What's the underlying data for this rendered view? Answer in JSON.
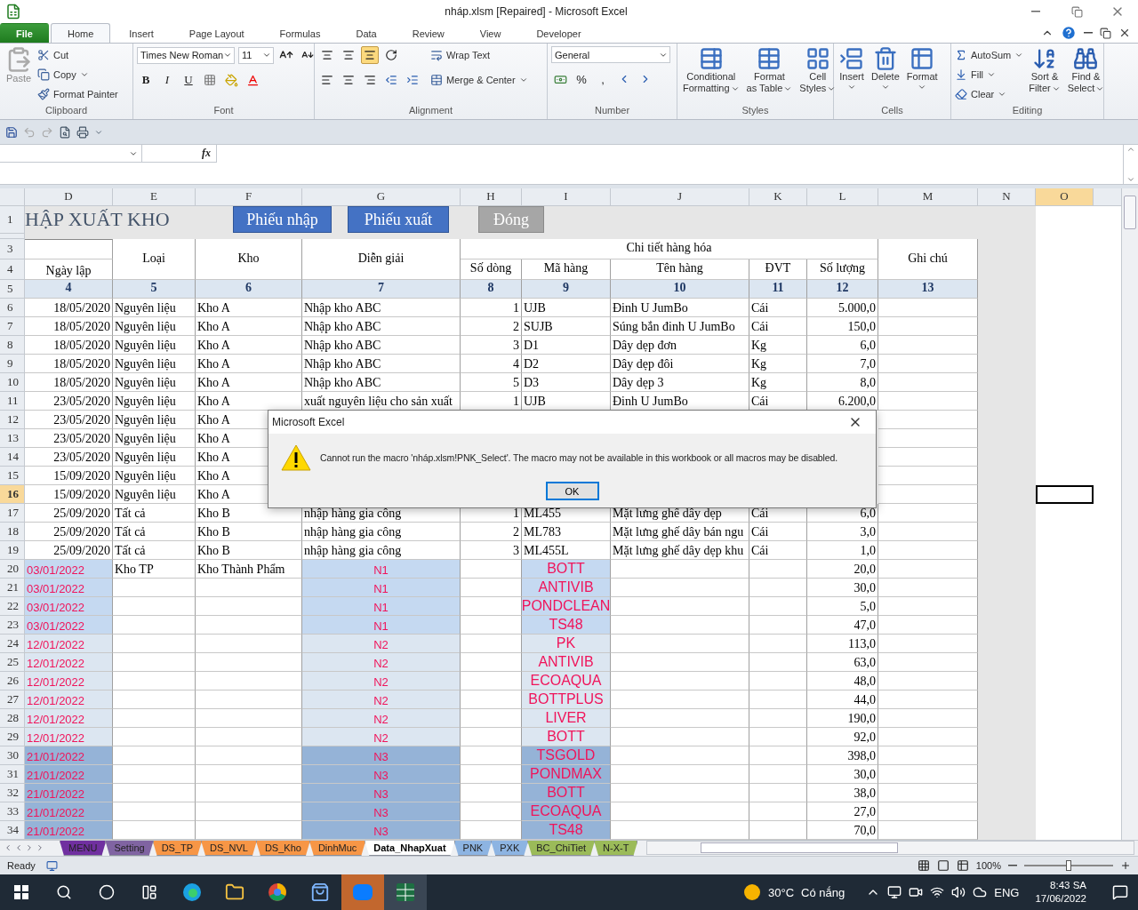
{
  "window": {
    "title": "nháp.xlsm [Repaired]  -  Microsoft Excel"
  },
  "ribbon_tabs": [
    {
      "label": "File",
      "kind": "file",
      "selected": false
    },
    {
      "label": "Home",
      "kind": "tab",
      "selected": true
    },
    {
      "label": "Insert",
      "kind": "tab",
      "selected": false
    },
    {
      "label": "Page Layout",
      "kind": "tab",
      "selected": false
    },
    {
      "label": "Formulas",
      "kind": "tab",
      "selected": false
    },
    {
      "label": "Data",
      "kind": "tab",
      "selected": false
    },
    {
      "label": "Review",
      "kind": "tab",
      "selected": false
    },
    {
      "label": "View",
      "kind": "tab",
      "selected": false
    },
    {
      "label": "Developer",
      "kind": "tab",
      "selected": false
    }
  ],
  "clipboard": {
    "label": "Clipboard",
    "paste": {
      "label": "Paste",
      "disabled": true
    },
    "items": [
      {
        "label": "Cut",
        "dropdown": false
      },
      {
        "label": "Copy",
        "dropdown": true
      },
      {
        "label": "Format Painter",
        "dropdown": false
      }
    ]
  },
  "font": {
    "label": "Font",
    "name": "Times New Roman",
    "size": "11",
    "styles": [
      "B",
      "I",
      "U"
    ]
  },
  "alignment": {
    "label": "Alignment",
    "vertical": [
      {
        "selected": false
      },
      {
        "selected": false
      },
      {
        "selected": true
      }
    ],
    "wrap": "Wrap Text",
    "merge": "Merge & Center"
  },
  "number": {
    "label": "Number",
    "format": "General",
    "symbols": [
      "%",
      ","
    ]
  },
  "styles": {
    "label": "Styles",
    "items": [
      {
        "lines": [
          "Conditional",
          "Formatting"
        ]
      },
      {
        "lines": [
          "Format",
          "as Table"
        ]
      },
      {
        "lines": [
          "Cell",
          "Styles"
        ]
      }
    ]
  },
  "cells": {
    "label": "Cells",
    "items": [
      "Insert",
      "Delete",
      "Format"
    ]
  },
  "editing": {
    "label": "Editing",
    "small": [
      "AutoSum",
      "Fill",
      "Clear"
    ],
    "large": [
      {
        "lines": [
          "Sort &",
          "Filter"
        ]
      },
      {
        "lines": [
          "Find &",
          "Select"
        ]
      }
    ]
  },
  "formula_bar": {
    "fx": "fx"
  },
  "columns": [
    {
      "label": "D",
      "selected": false
    },
    {
      "label": "E",
      "selected": false
    },
    {
      "label": "F",
      "selected": false
    },
    {
      "label": "G",
      "selected": false
    },
    {
      "label": "H",
      "selected": false
    },
    {
      "label": "I",
      "selected": false
    },
    {
      "label": "J",
      "selected": false
    },
    {
      "label": "K",
      "selected": false
    },
    {
      "label": "L",
      "selected": false
    },
    {
      "label": "M",
      "selected": false
    },
    {
      "label": "N",
      "selected": false
    },
    {
      "label": "O",
      "selected": true
    }
  ],
  "title_row": {
    "number": "1",
    "title": "HẬP XUẤT KHO",
    "buttons": [
      {
        "label": "Phiếu nhập",
        "kind": "primary"
      },
      {
        "label": "Phiếu xuất",
        "kind": "primary"
      },
      {
        "label": "Đóng",
        "kind": "secondary"
      }
    ]
  },
  "header": {
    "row_numbers": [
      "3",
      "4",
      "5"
    ],
    "date": "Ngày lập",
    "type": "Loại",
    "warehouse": "Kho",
    "description": "Diễn giải",
    "detail": "Chi tiết hàng hóa",
    "sub": [
      "Số dòng",
      "Mã hàng",
      "Tên hàng",
      "ĐVT",
      "Số lượng"
    ],
    "note": "Ghi chú",
    "numbers": [
      "4",
      "5",
      "6",
      "7",
      "8",
      "9",
      "10",
      "11",
      "12",
      "13"
    ]
  },
  "rows": [
    {
      "n": "6",
      "kind": "text",
      "selected": false,
      "cells": {
        "D": "18/05/2020",
        "E": "Nguyên liệu",
        "F": "Kho A",
        "G": "Nhập kho ABC",
        "H": "1",
        "I": "UJB",
        "J": "Đinh U JumBo",
        "K": "Cái",
        "L": "5.000,0"
      }
    },
    {
      "n": "7",
      "kind": "text",
      "selected": false,
      "cells": {
        "D": "18/05/2020",
        "E": "Nguyên liệu",
        "F": "Kho A",
        "G": "Nhập kho ABC",
        "H": "2",
        "I": "SUJB",
        "J": "Súng bắn đinh U JumBo",
        "K": "Cái",
        "L": "150,0"
      }
    },
    {
      "n": "8",
      "kind": "text",
      "selected": false,
      "cells": {
        "D": "18/05/2020",
        "E": "Nguyên liệu",
        "F": "Kho A",
        "G": "Nhập kho ABC",
        "H": "3",
        "I": "D1",
        "J": "Dây dẹp đơn",
        "K": "Kg",
        "L": "6,0"
      }
    },
    {
      "n": "9",
      "kind": "text",
      "selected": false,
      "cells": {
        "D": "18/05/2020",
        "E": "Nguyên liệu",
        "F": "Kho A",
        "G": "Nhập kho ABC",
        "H": "4",
        "I": "D2",
        "J": "Dây dẹp đôi",
        "K": "Kg",
        "L": "7,0"
      }
    },
    {
      "n": "10",
      "kind": "text",
      "selected": false,
      "cells": {
        "D": "18/05/2020",
        "E": "Nguyên liệu",
        "F": "Kho A",
        "G": "Nhập kho ABC",
        "H": "5",
        "I": "D3",
        "J": "Dây dẹp 3",
        "K": "Kg",
        "L": "8,0"
      }
    },
    {
      "n": "11",
      "kind": "text",
      "selected": false,
      "cells": {
        "D": "23/05/2020",
        "E": "Nguyên liệu",
        "F": "Kho A",
        "G": "xuất nguyên liệu cho sản xuất",
        "H": "1",
        "I": "UJB",
        "J": "Đinh U JumBo",
        "K": "Cái",
        "L": "6.200,0"
      }
    },
    {
      "n": "12",
      "kind": "text",
      "selected": false,
      "cells": {
        "D": "23/05/2020",
        "E": "Nguyên liệu",
        "F": "Kho A"
      }
    },
    {
      "n": "13",
      "kind": "text",
      "selected": false,
      "cells": {
        "D": "23/05/2020",
        "E": "Nguyên liệu",
        "F": "Kho A"
      }
    },
    {
      "n": "14",
      "kind": "text",
      "selected": false,
      "cells": {
        "D": "23/05/2020",
        "E": "Nguyên liệu",
        "F": "Kho A"
      }
    },
    {
      "n": "15",
      "kind": "text",
      "selected": false,
      "cells": {
        "D": "15/09/2020",
        "E": "Nguyên liệu",
        "F": "Kho A"
      }
    },
    {
      "n": "16",
      "kind": "text",
      "selected": true,
      "cells": {
        "D": "15/09/2020",
        "E": "Nguyên liệu",
        "F": "Kho A"
      }
    },
    {
      "n": "17",
      "kind": "text",
      "selected": false,
      "cells": {
        "D": "25/09/2020",
        "E": "Tất cả",
        "F": "Kho B",
        "G": "nhập hàng gia công",
        "H": "1",
        "I": "ML455",
        "J": "Mặt lưng ghế dây dẹp",
        "K": "Cái",
        "L": "6,0"
      }
    },
    {
      "n": "18",
      "kind": "text",
      "selected": false,
      "cells": {
        "D": "25/09/2020",
        "E": "Tất cả",
        "F": "Kho B",
        "G": "nhập hàng gia công",
        "H": "2",
        "I": "ML783",
        "J": "Mặt lưng ghế dây bán ngu",
        "K": "Cái",
        "L": "3,0"
      }
    },
    {
      "n": "19",
      "kind": "text",
      "selected": false,
      "cells": {
        "D": "25/09/2020",
        "E": "Tất cả",
        "F": "Kho B",
        "G": "nhập hàng gia công",
        "H": "3",
        "I": "ML455L",
        "J": "Mặt lưng ghế dây dẹp khu",
        "K": "Cái",
        "L": "1,0"
      }
    },
    {
      "n": "20",
      "kind": "import",
      "selected": false,
      "color": "#c5d9f1",
      "cells": {
        "D": "03/01/2022",
        "E": "Kho TP",
        "F": "Kho Thành Phẩm",
        "G": "N1",
        "I": "BOTT",
        "L": "20,0"
      }
    },
    {
      "n": "21",
      "kind": "import",
      "selected": false,
      "color": "#c5d9f1",
      "cells": {
        "D": "03/01/2022",
        "G": "N1",
        "I": "ANTIVIB",
        "L": "30,0"
      }
    },
    {
      "n": "22",
      "kind": "import",
      "selected": false,
      "color": "#c5d9f1",
      "cells": {
        "D": "03/01/2022",
        "G": "N1",
        "I": "PONDCLEAN",
        "L": "5,0"
      }
    },
    {
      "n": "23",
      "kind": "import",
      "selected": false,
      "color": "#c5d9f1",
      "cells": {
        "D": "03/01/2022",
        "G": "N1",
        "I": "TS48",
        "L": "47,0"
      }
    },
    {
      "n": "24",
      "kind": "import",
      "selected": false,
      "color": "#dce6f1",
      "cells": {
        "D": "12/01/2022",
        "G": "N2",
        "I": "PK",
        "L": "113,0"
      }
    },
    {
      "n": "25",
      "kind": "import",
      "selected": false,
      "color": "#dce6f1",
      "cells": {
        "D": "12/01/2022",
        "G": "N2",
        "I": "ANTIVIB",
        "L": "63,0"
      }
    },
    {
      "n": "26",
      "kind": "import",
      "selected": false,
      "color": "#dce6f1",
      "cells": {
        "D": "12/01/2022",
        "G": "N2",
        "I": "ECOAQUA",
        "L": "48,0"
      }
    },
    {
      "n": "27",
      "kind": "import",
      "selected": false,
      "color": "#dce6f1",
      "cells": {
        "D": "12/01/2022",
        "G": "N2",
        "I": "BOTTPLUS",
        "L": "44,0"
      }
    },
    {
      "n": "28",
      "kind": "import",
      "selected": false,
      "color": "#dce6f1",
      "cells": {
        "D": "12/01/2022",
        "G": "N2",
        "I": "LIVER",
        "L": "190,0"
      }
    },
    {
      "n": "29",
      "kind": "import",
      "selected": false,
      "color": "#dce6f1",
      "cells": {
        "D": "12/01/2022",
        "G": "N2",
        "I": "BOTT",
        "L": "92,0"
      }
    },
    {
      "n": "30",
      "kind": "import",
      "selected": false,
      "color": "#95b3d7",
      "cells": {
        "D": "21/01/2022",
        "G": "N3",
        "I": "TSGOLD",
        "L": "398,0"
      }
    },
    {
      "n": "31",
      "kind": "import",
      "selected": false,
      "color": "#95b3d7",
      "cells": {
        "D": "21/01/2022",
        "G": "N3",
        "I": "PONDMAX",
        "L": "30,0"
      }
    },
    {
      "n": "32",
      "kind": "import",
      "selected": false,
      "color": "#95b3d7",
      "cells": {
        "D": "21/01/2022",
        "G": "N3",
        "I": "BOTT",
        "L": "38,0"
      }
    },
    {
      "n": "33",
      "kind": "import",
      "selected": false,
      "color": "#95b3d7",
      "cells": {
        "D": "21/01/2022",
        "G": "N3",
        "I": "ECOAQUA",
        "L": "27,0"
      }
    },
    {
      "n": "34",
      "kind": "import",
      "selected": false,
      "color": "#95b3d7",
      "cells": {
        "D": "21/01/2022",
        "G": "N3",
        "I": "TS48",
        "L": "70,0"
      }
    }
  ],
  "sheet_tabs": [
    {
      "label": "MENU",
      "color": "#7030a0",
      "selected": false
    },
    {
      "label": "Setting",
      "color": "#8064a2",
      "selected": false
    },
    {
      "label": "DS_TP",
      "color": "#f79646",
      "selected": false
    },
    {
      "label": "DS_NVL",
      "color": "#f79646",
      "selected": false
    },
    {
      "label": "DS_Kho",
      "color": "#f79646",
      "selected": false
    },
    {
      "label": "DinhMuc",
      "color": "#f79646",
      "selected": false
    },
    {
      "label": "Data_NhapXuat",
      "color": "#ffffff",
      "selected": true
    },
    {
      "label": "PNK",
      "color": "#8db4e2",
      "selected": false
    },
    {
      "label": "PXK",
      "color": "#8db4e2",
      "selected": false
    },
    {
      "label": "BC_ChiTiet",
      "color": "#9bbb59",
      "selected": false
    },
    {
      "label": "N-X-T",
      "color": "#9bbb59",
      "selected": false
    }
  ],
  "status_bar": {
    "status": "Ready",
    "zoom": "100%",
    "zoom_slider": {
      "level": 0.5
    }
  },
  "dialog": {
    "title": "Microsoft Excel",
    "message": "Cannot run the macro 'nháp.xlsm!PNK_Select'. The macro may not be available in this workbook or all macros may be disabled.",
    "button": "OK"
  },
  "taskbar": {
    "temperature": "30°C",
    "weather": "Có nắng",
    "language": "ENG",
    "time": "8:43 SA",
    "date": "17/06/2022"
  }
}
